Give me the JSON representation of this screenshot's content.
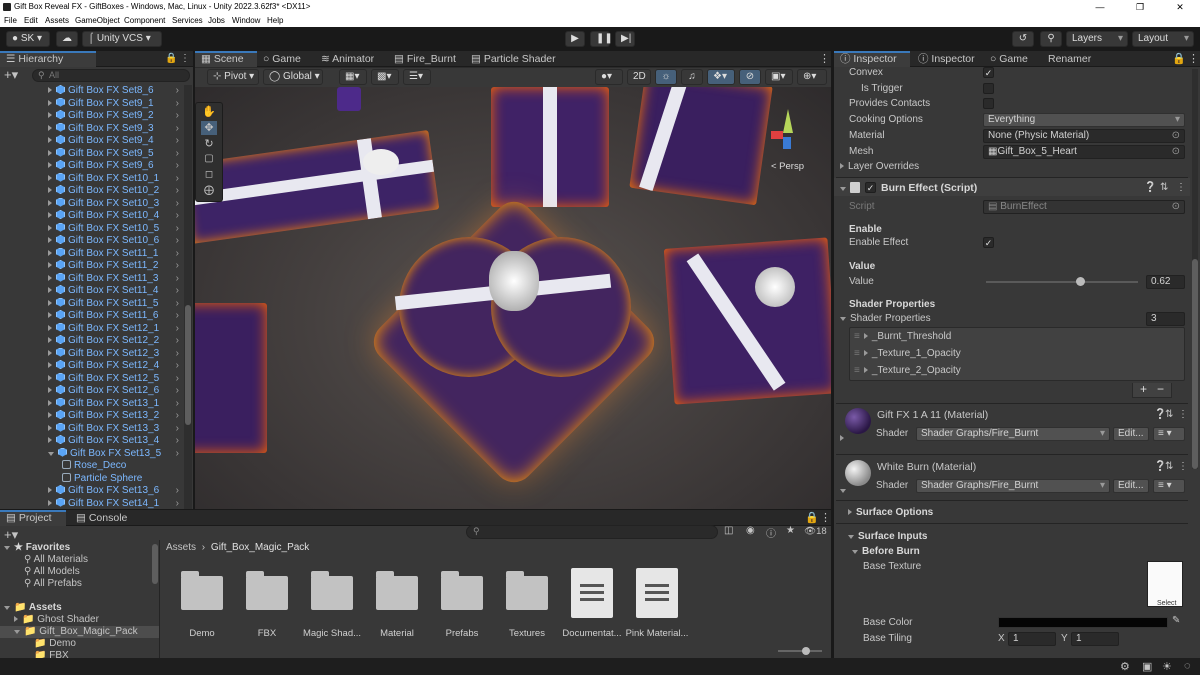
{
  "window": {
    "title": "Gift Box Reveal FX - GiftBoxes - Windows, Mac, Linux - Unity 2022.3.62f3* <DX11>"
  },
  "menu": [
    "File",
    "Edit",
    "Assets",
    "GameObject",
    "Component",
    "Services",
    "Jobs",
    "Window",
    "Help"
  ],
  "toolbar": {
    "account": "SK",
    "vcs": "Unity VCS",
    "layers": "Layers",
    "layout": "Layout"
  },
  "hierarchy": {
    "tab": "Hierarchy",
    "search_placeholder": "All",
    "items": [
      "Gift Box FX Set8_6",
      "Gift Box FX Set9_1",
      "Gift Box FX Set9_2",
      "Gift Box FX Set9_3",
      "Gift Box FX Set9_4",
      "Gift Box FX Set9_5",
      "Gift Box FX Set9_6",
      "Gift Box FX Set10_1",
      "Gift Box FX Set10_2",
      "Gift Box FX Set10_3",
      "Gift Box FX Set10_4",
      "Gift Box FX Set10_5",
      "Gift Box FX Set10_6",
      "Gift Box FX Set11_1",
      "Gift Box FX Set11_2",
      "Gift Box FX Set11_3",
      "Gift Box FX Set11_4",
      "Gift Box FX Set11_5",
      "Gift Box FX Set11_6",
      "Gift Box FX Set12_1",
      "Gift Box FX Set12_2",
      "Gift Box FX Set12_3",
      "Gift Box FX Set12_4",
      "Gift Box FX Set12_5",
      "Gift Box FX Set12_6",
      "Gift Box FX Set13_1",
      "Gift Box FX Set13_2",
      "Gift Box FX Set13_3",
      "Gift Box FX Set13_4",
      "Gift Box FX Set13_5"
    ],
    "children": [
      "Rose_Deco",
      "Particle Sphere"
    ],
    "after": [
      "Gift Box FX Set13_6",
      "Gift Box FX Set14_1"
    ]
  },
  "scene_tabs": [
    "Scene",
    "Game",
    "Animator",
    "Fire_Burnt",
    "Particle Shader"
  ],
  "scene_toolbar": {
    "pivot": "Pivot",
    "global": "Global",
    "mode2d": "2D",
    "persp": "< Persp"
  },
  "project": {
    "tabs": [
      "Project",
      "Console"
    ],
    "favorites_label": "Favorites",
    "favorites": [
      "All Materials",
      "All Models",
      "All Prefabs"
    ],
    "assets_label": "Assets",
    "asset_tree": [
      "Ghost Shader",
      "Gift_Box_Magic_Pack",
      "Demo",
      "FBX"
    ],
    "breadcrumb": [
      "Assets",
      "Gift_Box_Magic_Pack"
    ],
    "hidden_count": "18",
    "files": [
      {
        "name": "Demo",
        "kind": "folder"
      },
      {
        "name": "FBX",
        "kind": "folder"
      },
      {
        "name": "Magic Shad...",
        "kind": "folder"
      },
      {
        "name": "Material",
        "kind": "folder"
      },
      {
        "name": "Prefabs",
        "kind": "folder"
      },
      {
        "name": "Textures",
        "kind": "folder"
      },
      {
        "name": "Documentat...",
        "kind": "doc"
      },
      {
        "name": "Pink Material...",
        "kind": "doc"
      }
    ]
  },
  "inspector": {
    "tabs": [
      "Inspector",
      "Inspector",
      "Game",
      "Renamer"
    ],
    "collider": {
      "convex": "Convex",
      "is_trigger": "Is Trigger",
      "provides_contacts": "Provides Contacts",
      "cooking_options": "Cooking Options",
      "cooking_value": "Everything",
      "material": "Material",
      "material_value": "None (Physic Material)",
      "mesh": "Mesh",
      "mesh_value": "Gift_Box_5_Heart",
      "layer_overrides": "Layer Overrides"
    },
    "burn": {
      "title": "Burn Effect (Script)",
      "script_label": "Script",
      "script_value": "BurnEffect",
      "enable_header": "Enable",
      "enable_label": "Enable Effect",
      "value_header": "Value",
      "value_label": "Value",
      "value": "0.62",
      "slider_fraction": 0.62,
      "shader_header": "Shader Properties",
      "shader_label": "Shader Properties",
      "shader_count": "3",
      "props": [
        "_Burnt_Threshold",
        "_Texture_1_Opacity",
        "_Texture_2_Opacity"
      ]
    },
    "materials": [
      {
        "name": "Gift FX 1 A 11 (Material)",
        "shader_label": "Shader",
        "shader": "Shader Graphs/Fire_Burnt",
        "edit": "Edit..."
      },
      {
        "name": "White Burn (Material)",
        "shader_label": "Shader",
        "shader": "Shader Graphs/Fire_Burnt",
        "edit": "Edit..."
      }
    ],
    "surface_options": "Surface Options",
    "surface_inputs": "Surface Inputs",
    "before_burn": "Before Burn",
    "base_texture": "Base Texture",
    "select": "Select",
    "base_color": "Base Color",
    "base_tiling": "Base Tiling",
    "tiling_x_label": "X",
    "tiling_x": "1",
    "tiling_y_label": "Y",
    "tiling_y": "1"
  },
  "colors": {
    "accent": "#3a79bb",
    "hierarchy_text": "#7cb8ff",
    "panel": "#383838",
    "scene_floor": "#4a4548"
  }
}
